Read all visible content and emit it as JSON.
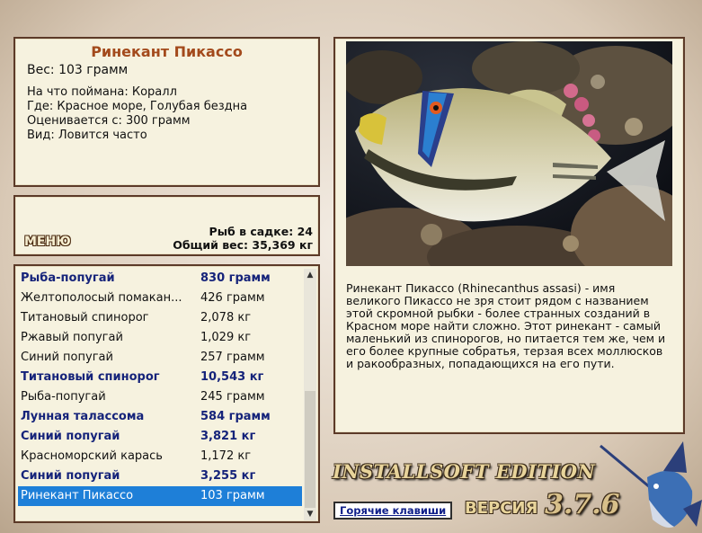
{
  "info": {
    "title": "Ринекант Пикассо",
    "weight": "Вес: 103 грамм",
    "caught_on": "На что поймана: Коралл",
    "location": "Где: Красное море, Голубая бездна",
    "rated_from": "Оценивается с: 300 грамм",
    "kind": "Вид: Ловится часто"
  },
  "status": {
    "menu_label": "МЕНЮ",
    "fish_in_net": "Рыб в садке: 24",
    "total_weight": "Общий вес: 35,369 кг"
  },
  "catch_list": [
    {
      "name": "Рыба-попугай",
      "weight": "830 грамм",
      "bold": true
    },
    {
      "name": "Желтополосый помакан...",
      "weight": "426 грамм",
      "bold": false
    },
    {
      "name": "Титановый спинорог",
      "weight": "2,078 кг",
      "bold": false
    },
    {
      "name": "Ржавый попугай",
      "weight": "1,029 кг",
      "bold": false
    },
    {
      "name": "Синий попугай",
      "weight": "257 грамм",
      "bold": false
    },
    {
      "name": "Титановый спинорог",
      "weight": "10,543 кг",
      "bold": true
    },
    {
      "name": "Рыба-попугай",
      "weight": "245 грамм",
      "bold": false
    },
    {
      "name": "Лунная талассома",
      "weight": "584 грамм",
      "bold": true
    },
    {
      "name": "Синий попугай",
      "weight": "3,821 кг",
      "bold": true
    },
    {
      "name": "Красноморский карась",
      "weight": "1,172 кг",
      "bold": false
    },
    {
      "name": "Синий попугай",
      "weight": "3,255 кг",
      "bold": true
    },
    {
      "name": "Ринекант Пикассо",
      "weight": "103 грамм",
      "bold": false,
      "selected": true
    }
  ],
  "description": "Ринекант Пикассо (Rhinecanthus assasi) - имя великого Пикассо не зря стоит рядом с названием этой скромной рыбки - более странных созданий в Красном море найти сложно. Этот ринекант - самый маленький из спинорогов, но питается тем же, чем и его более крупные собратья, терзая всех моллюсков и ракообразных, попадающихся на его пути.",
  "footer": {
    "edition": "INSTALLSOFT EDITION",
    "hotkeys_label": "Горячие клавиши",
    "version_label": "ВЕРСИЯ",
    "version_number": "3.7.6"
  },
  "colors": {
    "panel_bg": "#f6f2df",
    "panel_border": "#5c3a28",
    "title_color": "#a34a1c",
    "bold_row_color": "#15237a",
    "selection_color": "#1e7fd8"
  }
}
